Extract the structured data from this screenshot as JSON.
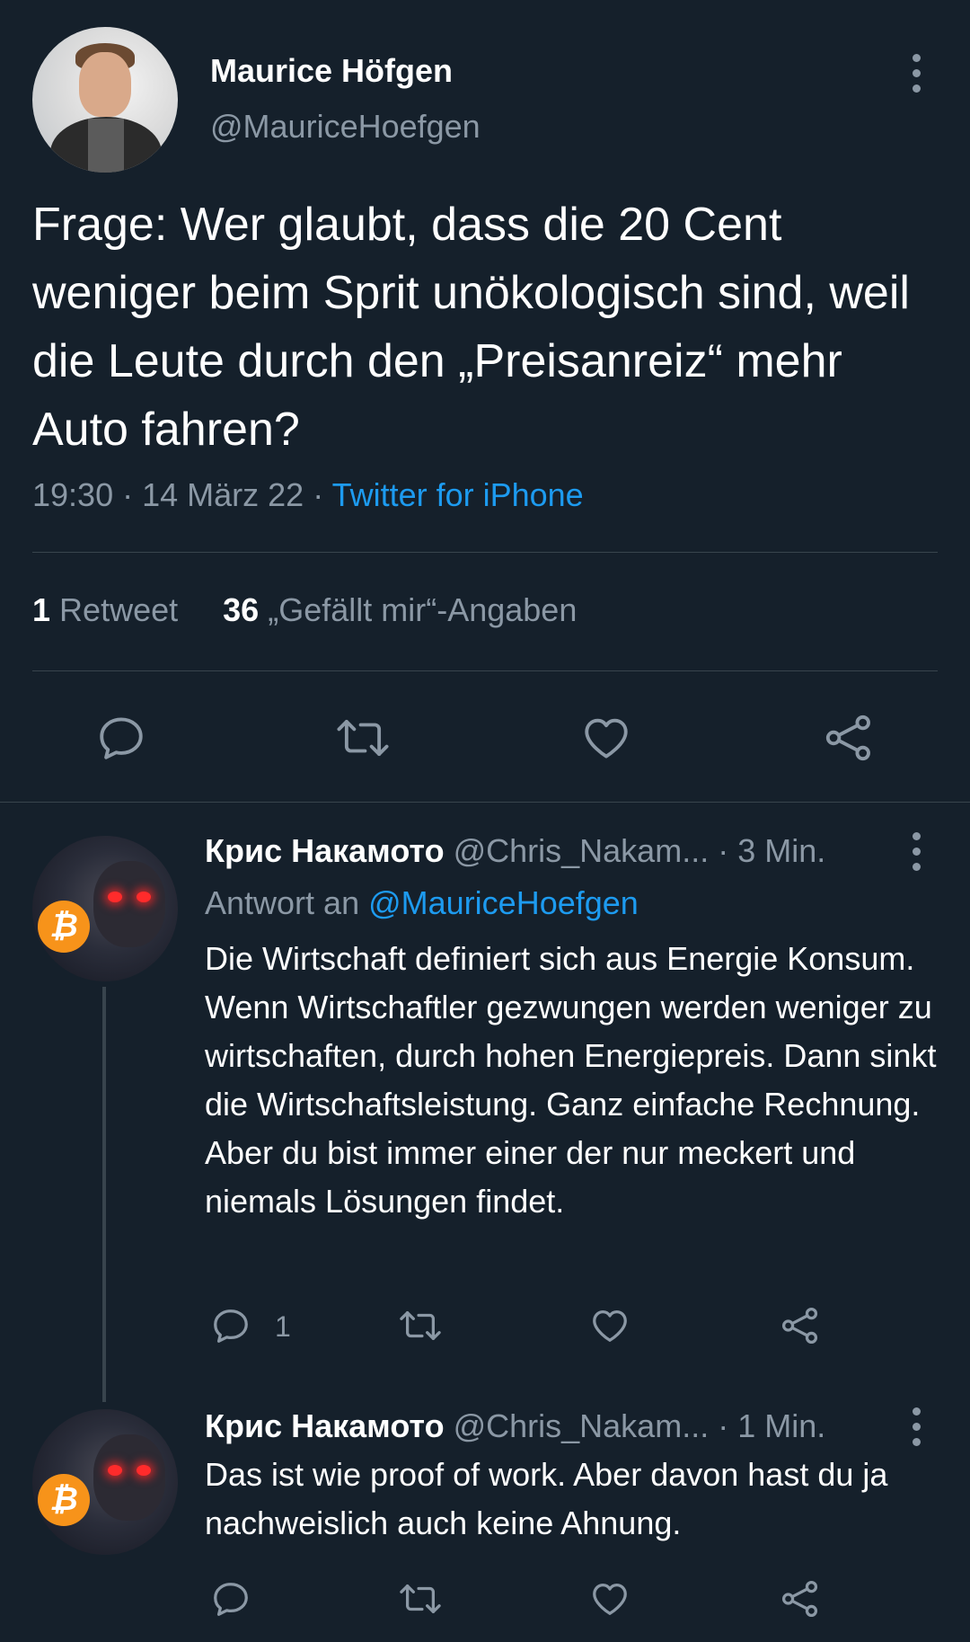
{
  "tweet": {
    "author_name": "Maurice Höfgen",
    "author_handle": "@MauriceHoefgen",
    "text": "Frage: Wer glaubt, dass die 20 Cent weniger beim Sprit unökologisch sind, weil die Leute durch den „Preisanreiz“ mehr Auto fahren?",
    "time": "19:30",
    "date": "14 März 22",
    "source": "Twitter for iPhone",
    "retweet_count": "1",
    "retweet_label": "Retweet",
    "like_count": "36",
    "like_label": "„Gefällt mir“-Angaben",
    "icons": [
      "avatar",
      "more-icon",
      "reply-icon",
      "retweet-icon",
      "like-icon",
      "share-icon"
    ]
  },
  "replies": [
    {
      "author_name": "Крис Накамото",
      "author_handle": "@Chris_Nakam...",
      "time": "· 3 Min.",
      "replying_label": "Antwort an",
      "replying_to": "@MauriceHoefgen",
      "text": "Die Wirtschaft definiert sich aus Energie Konsum. Wenn Wirtschaftler gezwungen werden weniger zu wirtschaften, durch hohen Energiepreis. Dann sinkt die Wirtschaftsleistung. Ganz einfache Rechnung. Aber du bist immer einer der nur meckert und niemals Lösungen findet.",
      "reply_count": "1"
    },
    {
      "author_name": "Крис Накамото",
      "author_handle": "@Chris_Nakam...",
      "time": "· 1 Min.",
      "text": "Das ist wie proof of work. Aber davon hast du ja nachweislich auch keine Ahnung."
    }
  ],
  "colors": {
    "background": "#15202b",
    "secondary_text": "#8b98a5",
    "link": "#1d9bf0",
    "divider": "#38444d",
    "bitcoin": "#f7931a"
  }
}
